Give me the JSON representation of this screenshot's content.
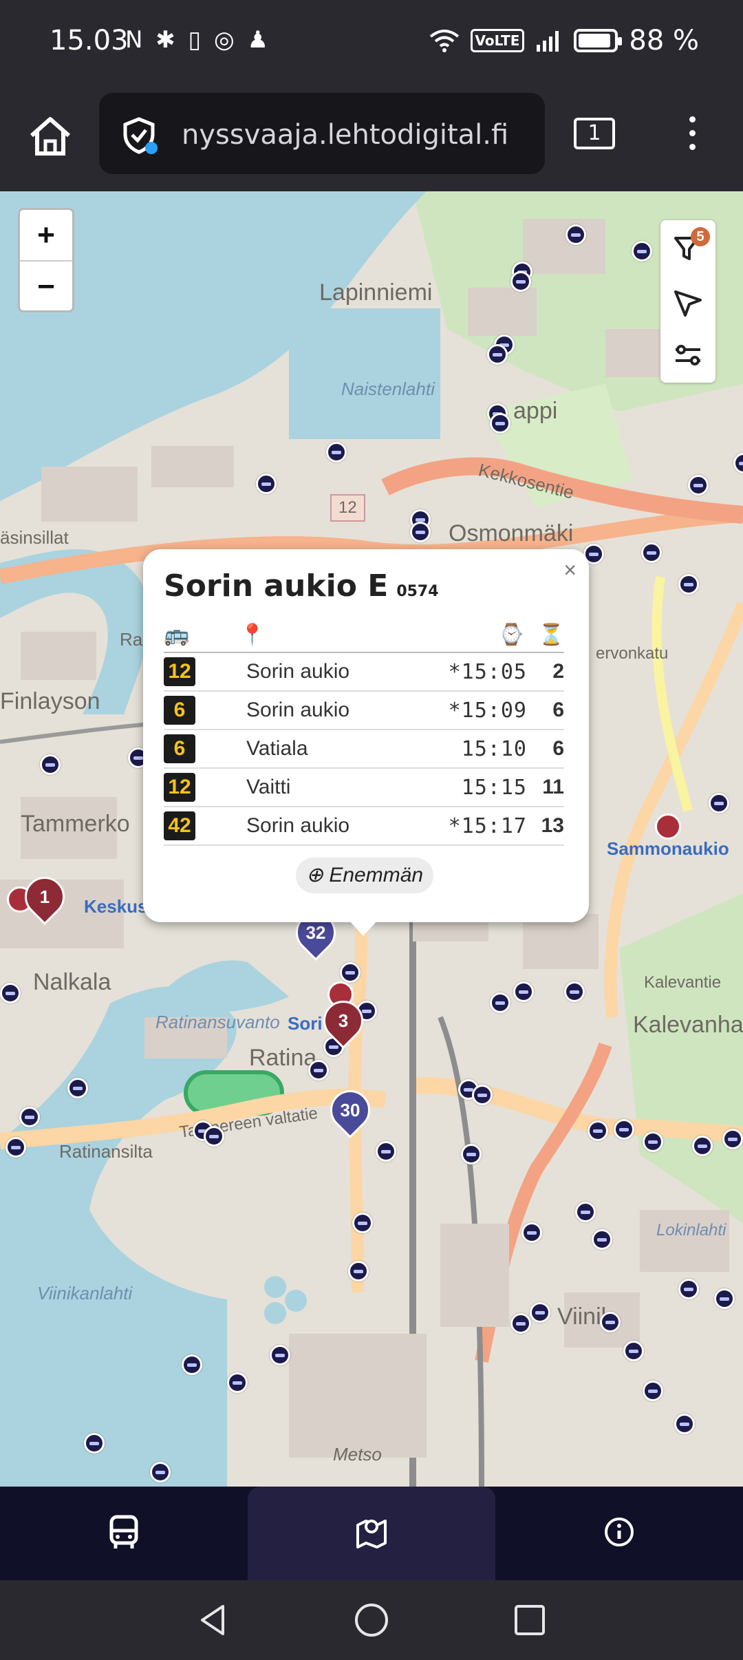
{
  "status_bar": {
    "time": "15.03",
    "left_icons": "N ✱ ▯ ◎ ♟",
    "volte": "VoLTE",
    "battery_text": "88 %",
    "battery_level_percent": 88
  },
  "browser": {
    "url": "nyssvaaja.lehtodigital.fi",
    "tab_count": "1"
  },
  "map": {
    "zoom_in": "+",
    "zoom_out": "−",
    "filter_count": "5",
    "labels": {
      "lapinniemi": "Lapinniemi",
      "naistenlahti": "Naistenlahti",
      "tammela_lappi": "appi",
      "kekkosentie": "Kekkosentie",
      "osmonmaki": "Osmonmäki",
      "asinsillat": "äsinsillat",
      "finlayson": "Finlayson",
      "tammerkoski": "Tammerko",
      "keskus": "Keskus",
      "nalkala": "Nalkala",
      "ratinansuvanto": "Ratinansuvanto",
      "ratina": "Ratina",
      "ratinansilta": "Ratinansilta",
      "tampereen_valtatie": "Tampereen valtatie",
      "viinikanlahti": "Viinikanlahti",
      "metso": "Metso",
      "viinikka": "Viinik",
      "kalevantie": "Kalevantie",
      "kalevanharju": "Kalevanha",
      "sammonaukio": "Sammonaukio",
      "lokinlahti": "Lokinlahti",
      "road_12": "12",
      "rai": "Ra",
      "sorin": "Sori",
      "ervonkatu": "ervonkatu"
    },
    "pins": [
      {
        "label": "1",
        "color": "#8c2a35"
      },
      {
        "label": "32",
        "color": "#4a4a9a"
      },
      {
        "label": "3",
        "color": "#8c2a35"
      },
      {
        "label": "30",
        "color": "#4a4a9a"
      }
    ]
  },
  "popup": {
    "stop_name": "Sorin aukio E",
    "stop_code": "0574",
    "close": "×",
    "headers": {
      "line": "🚌",
      "dest": "📍",
      "time": "⌚",
      "wait": "⏳"
    },
    "departures": [
      {
        "line": "12",
        "dest": "Sorin aukio",
        "time": "*15:05",
        "mins": "2"
      },
      {
        "line": "6",
        "dest": "Sorin aukio",
        "time": "*15:09",
        "mins": "6"
      },
      {
        "line": "6",
        "dest": "Vatiala",
        "time": "15:10",
        "mins": "6"
      },
      {
        "line": "12",
        "dest": "Vaitti",
        "time": "15:15",
        "mins": "11"
      },
      {
        "line": "42",
        "dest": "Sorin aukio",
        "time": "*15:17",
        "mins": "13"
      }
    ],
    "more_label": "⊕ Enemmän"
  },
  "colors": {
    "bus_stop": "#1c1a4a",
    "line_badge_bg": "#1b1b1b",
    "line_badge_text": "#f5c315",
    "nav_bg": "#101128",
    "nav_active": "#232042"
  }
}
